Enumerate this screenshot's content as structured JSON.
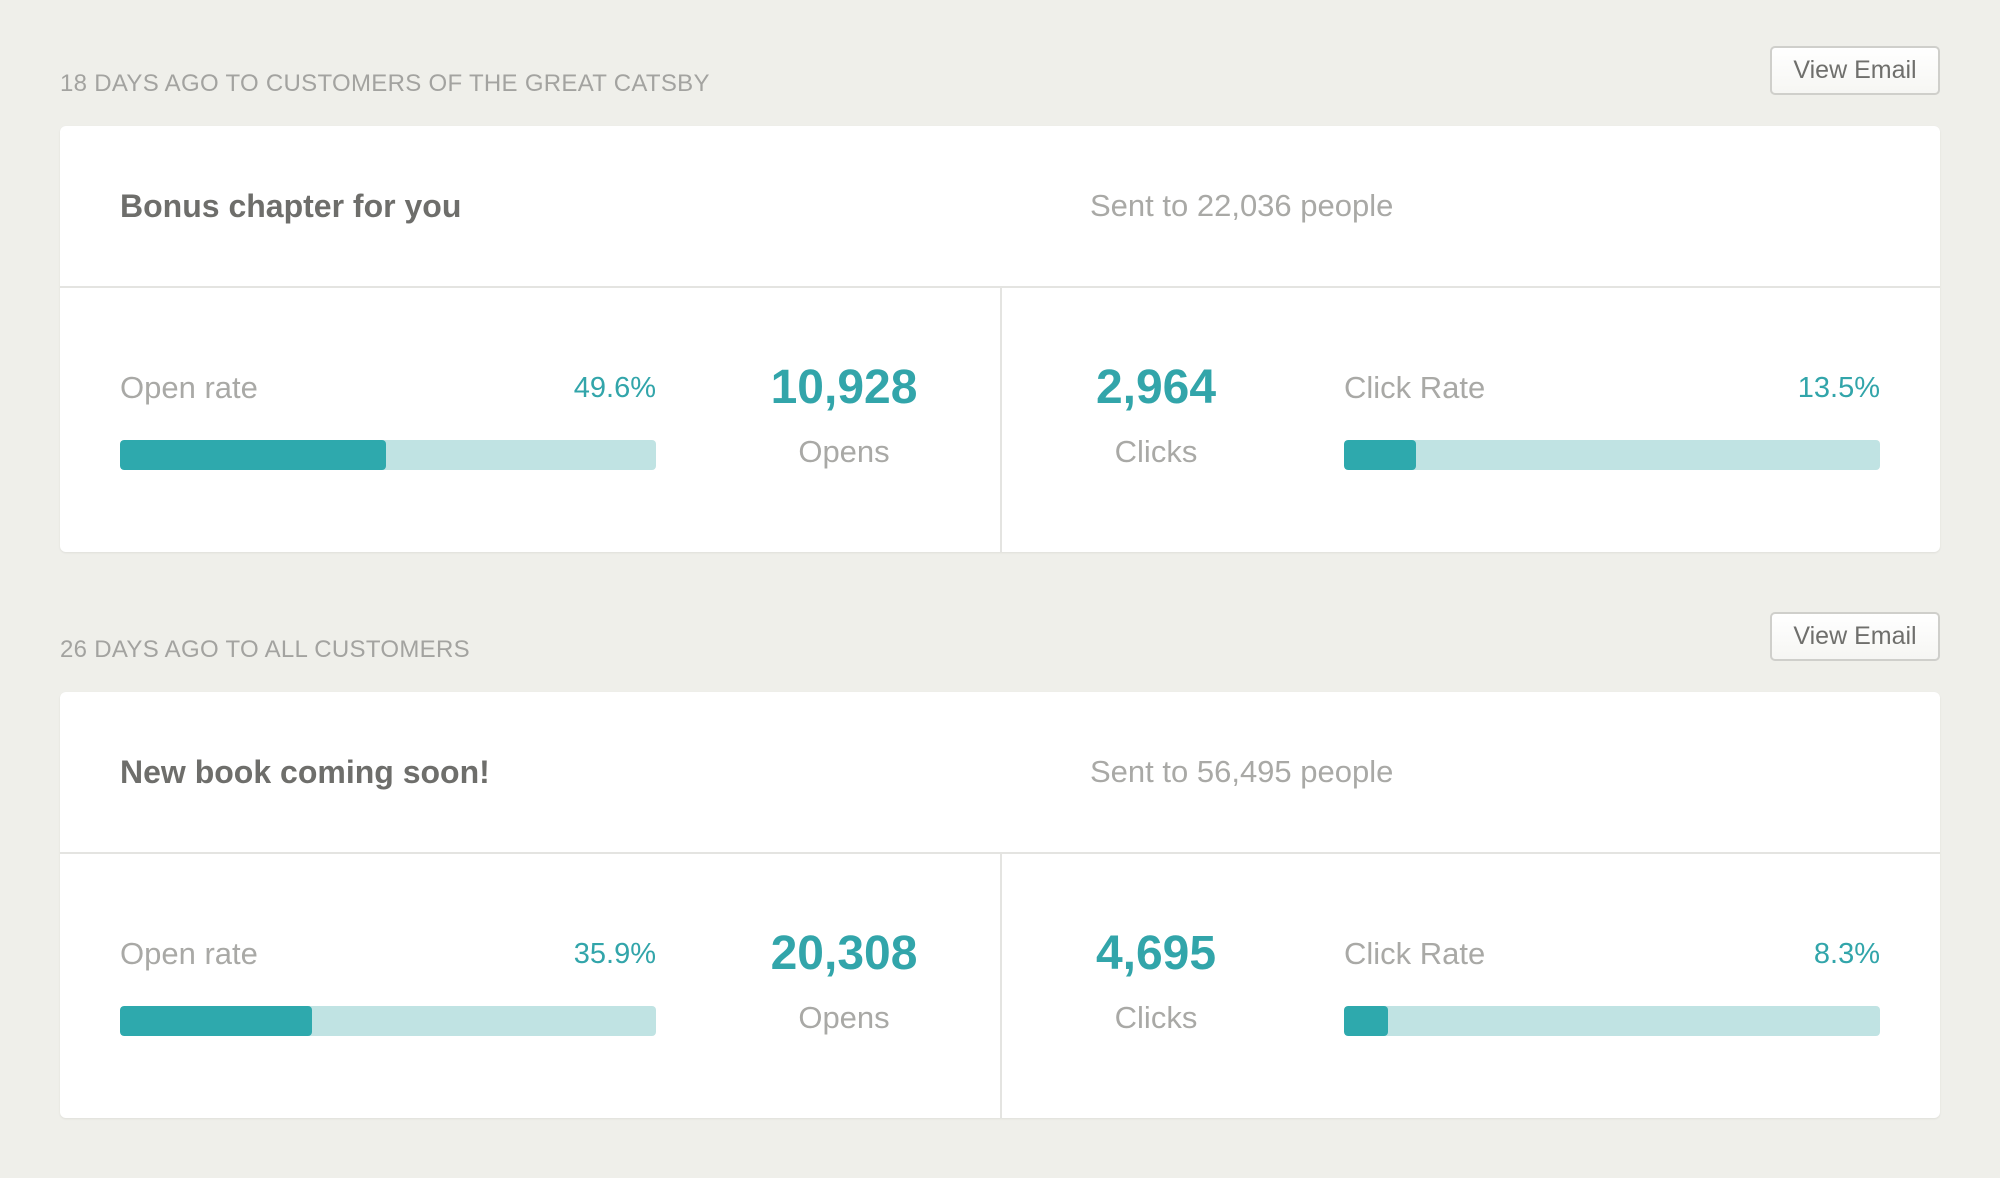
{
  "colors": {
    "page_background": "#efefea",
    "accent": "#2ea9ad",
    "bar_track": "#c0e3e3",
    "muted_text": "#a9a9a6",
    "dark_text": "#6e6e6b"
  },
  "campaigns": [
    {
      "meta": "18 DAYS AGO TO CUSTOMERS OF THE GREAT CATSBY",
      "view_email_label": "View Email",
      "subject": "Bonus chapter for you",
      "sent_to": "Sent to 22,036 people",
      "open_rate_label": "Open rate",
      "open_rate_percent": "49.6%",
      "open_rate_value": 0.496,
      "opens_count": "10,928",
      "opens_label": "Opens",
      "clicks_count": "2,964",
      "clicks_label": "Clicks",
      "click_rate_label": "Click Rate",
      "click_rate_percent": "13.5%",
      "click_rate_value": 0.135
    },
    {
      "meta": "26 DAYS AGO TO ALL CUSTOMERS",
      "view_email_label": "View Email",
      "subject": "New book coming soon!",
      "sent_to": "Sent to 56,495 people",
      "open_rate_label": "Open rate",
      "open_rate_percent": "35.9%",
      "open_rate_value": 0.359,
      "opens_count": "20,308",
      "opens_label": "Opens",
      "clicks_count": "4,695",
      "clicks_label": "Clicks",
      "click_rate_label": "Click Rate",
      "click_rate_percent": "8.3%",
      "click_rate_value": 0.083
    }
  ]
}
